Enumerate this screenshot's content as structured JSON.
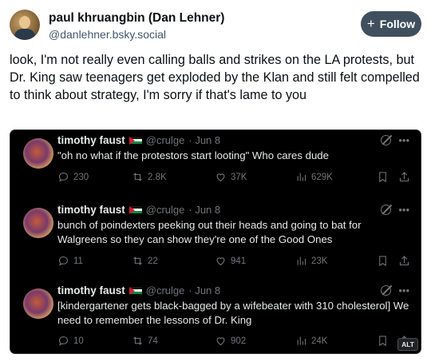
{
  "post": {
    "author_name": "paul khruangbin (Dan Lehner)",
    "author_handle": "@danlehner.bsky.social",
    "follow_label": "Follow",
    "follow_icon": "plus-icon",
    "text": "look, I'm not really even calling balls and strikes on the LA protests, but Dr. King saw teenagers get exploded by the Klan and still felt compelled to think about strategy, I'm sorry if that's lame to you"
  },
  "embed": {
    "alt_badge": "ALT",
    "tweets": [
      {
        "name": "timothy faust",
        "flag": "palestine-flag-icon",
        "handle": "@crulge",
        "time": "· Jun 8",
        "text": "\"oh no what if the protestors start looting\" Who cares dude",
        "replies": "230",
        "reposts": "2.8K",
        "likes": "37K",
        "views": "629K"
      },
      {
        "name": "timothy faust",
        "flag": "palestine-flag-icon",
        "handle": "@crulge",
        "time": "· Jun 8",
        "text": "bunch of poindexters peeking out their heads and going to bat for Walgreens so they can show they're one of the Good Ones",
        "replies": "11",
        "reposts": "22",
        "likes": "941",
        "views": "23K"
      },
      {
        "name": "timothy faust",
        "flag": "palestine-flag-icon",
        "handle": "@crulge",
        "time": "· Jun 8",
        "text": "[kindergartener gets black-bagged by a wifebeater with 310 cholesterol] We need to remember the lessons of Dr. King",
        "replies": "10",
        "reposts": "74",
        "likes": "902",
        "views": "24K"
      }
    ]
  }
}
